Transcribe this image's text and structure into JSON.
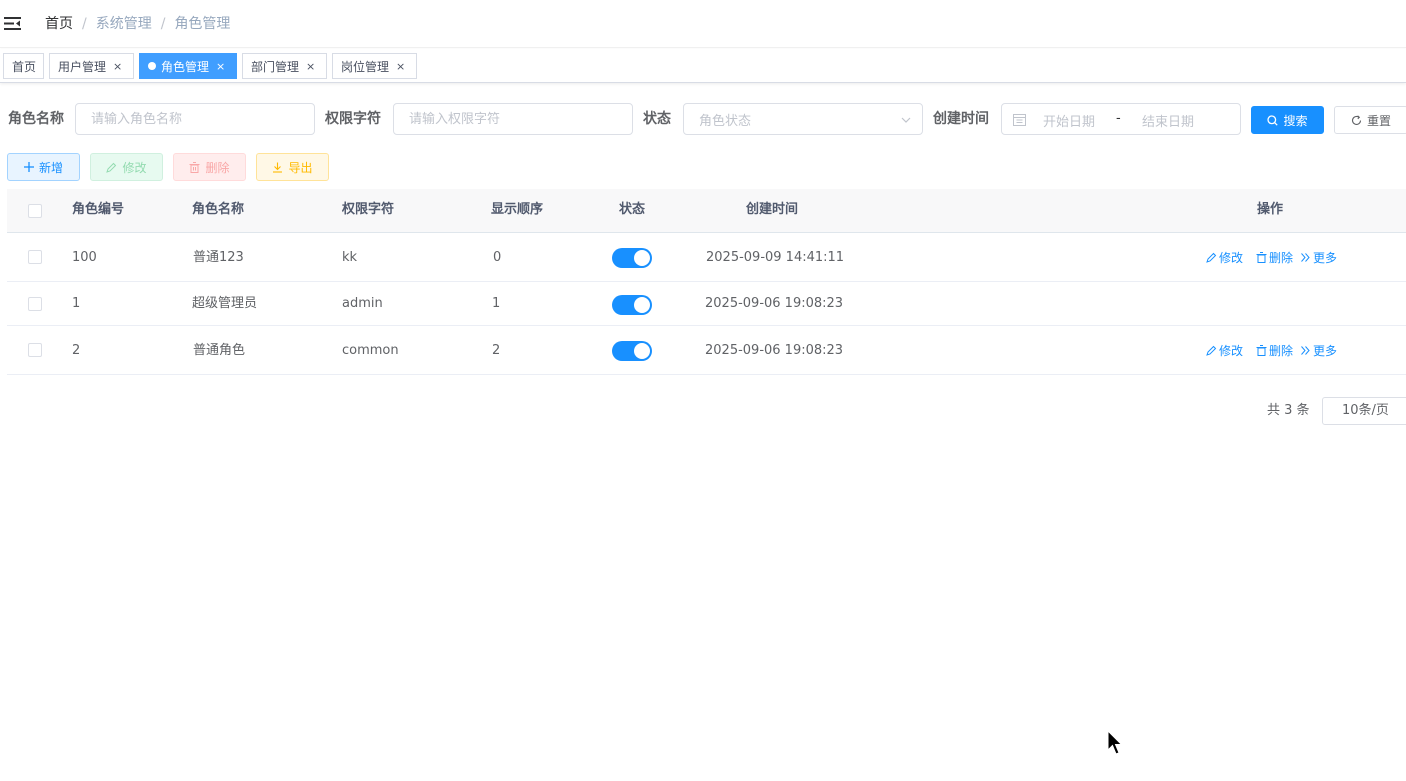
{
  "breadcrumb": [
    "首页",
    "系统管理",
    "角色管理"
  ],
  "tabs": [
    {
      "label": "首页",
      "active": false,
      "closable": false
    },
    {
      "label": "用户管理",
      "active": false,
      "closable": true
    },
    {
      "label": "角色管理",
      "active": true,
      "closable": true
    },
    {
      "label": "部门管理",
      "active": false,
      "closable": true
    },
    {
      "label": "岗位管理",
      "active": false,
      "closable": true
    }
  ],
  "tab_close_glyph": "×",
  "search": {
    "role_name_label": "角色名称",
    "role_name_placeholder": "请输入角色名称",
    "role_key_label": "权限字符",
    "role_key_placeholder": "请输入权限字符",
    "status_label": "状态",
    "status_placeholder": "角色状态",
    "create_time_label": "创建时间",
    "start_placeholder": "开始日期",
    "range_separator": "-",
    "end_placeholder": "结束日期",
    "search_button": "搜索",
    "reset_button": "重置"
  },
  "toolbar": {
    "add": "新增",
    "edit": "修改",
    "delete": "删除",
    "export": "导出"
  },
  "table": {
    "headers": [
      "角色编号",
      "角色名称",
      "权限字符",
      "显示顺序",
      "状态",
      "创建时间",
      "操作"
    ],
    "rows": [
      {
        "id": "100",
        "name": "普通123",
        "key": "kk",
        "sort": "0",
        "status_on": true,
        "create_time": "2025-09-09 14:41:11",
        "has_actions": true
      },
      {
        "id": "1",
        "name": "超级管理员",
        "key": "admin",
        "sort": "1",
        "status_on": true,
        "create_time": "2025-09-06 19:08:23",
        "has_actions": false
      },
      {
        "id": "2",
        "name": "普通角色",
        "key": "common",
        "sort": "2",
        "status_on": true,
        "create_time": "2025-09-06 19:08:23",
        "has_actions": true
      }
    ],
    "actions": {
      "edit": "修改",
      "delete": "删除",
      "more": "更多"
    }
  },
  "pagination": {
    "total": "共 3 条",
    "page_size": "10条/页"
  },
  "colors": {
    "primary": "#1890ff",
    "active_tab": "#409eff"
  }
}
